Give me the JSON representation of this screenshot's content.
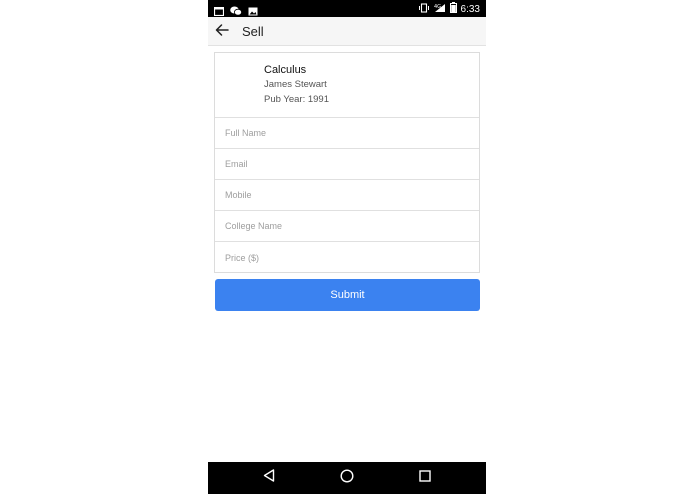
{
  "status_bar": {
    "time": "6:33",
    "left_icons": [
      "window-icon",
      "wechat-icon",
      "image-icon"
    ],
    "right_icons": [
      "vibrate-icon",
      "signal-icon",
      "battery-icon"
    ]
  },
  "app_bar": {
    "title": "Sell",
    "back_icon": "arrow-left-icon"
  },
  "book": {
    "title": "Calculus",
    "author": "James Stewart",
    "pub_year": "Pub Year: 1991"
  },
  "form": {
    "full_name": {
      "placeholder": "Full Name",
      "value": ""
    },
    "email": {
      "placeholder": "Email",
      "value": ""
    },
    "mobile": {
      "placeholder": "Mobile",
      "value": ""
    },
    "college": {
      "placeholder": "College Name",
      "value": ""
    },
    "price": {
      "placeholder": "Price ($)",
      "value": ""
    }
  },
  "submit_label": "Submit",
  "colors": {
    "accent": "#3b82f0",
    "status_bar": "#000000",
    "app_bar": "#f6f6f6"
  },
  "nav_bar": {
    "buttons": [
      "back-triangle-icon",
      "home-circle-icon",
      "recents-square-icon"
    ]
  }
}
